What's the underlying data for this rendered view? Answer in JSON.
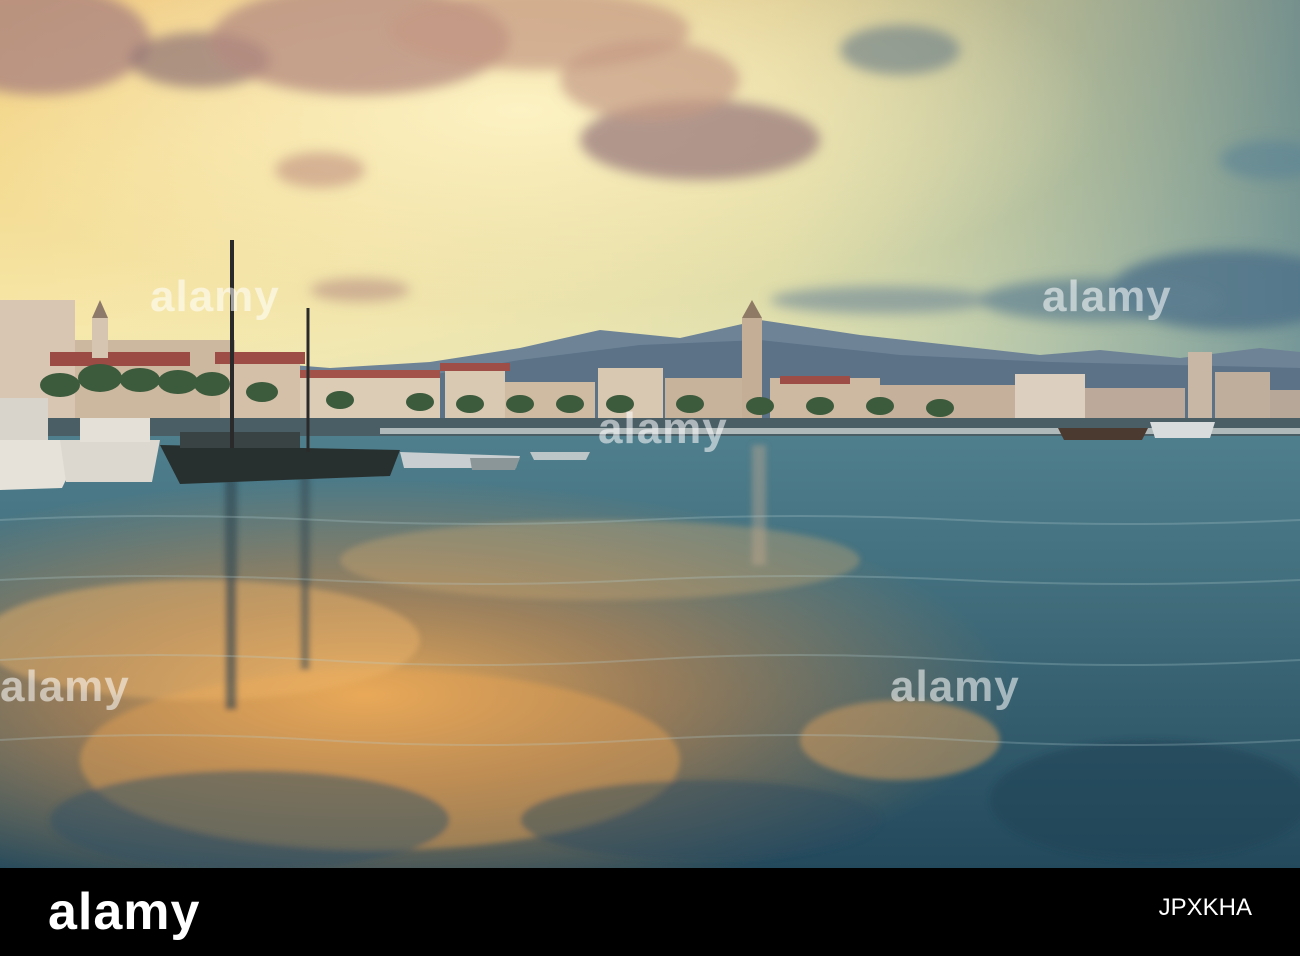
{
  "watermark": {
    "text": "alamy",
    "color": "#ffffff"
  },
  "footer": {
    "logo": "alamy",
    "image_id": "JPXKHA",
    "background": "#000000"
  },
  "scene": {
    "description_colors": {
      "sky_top": "#6fb0b2",
      "sky_mid": "#f2d98a",
      "horizon": "#f6e6a0",
      "mountains": "#5a7287",
      "water_dark": "#2c5468",
      "water_glow": "#e9a24a"
    }
  }
}
